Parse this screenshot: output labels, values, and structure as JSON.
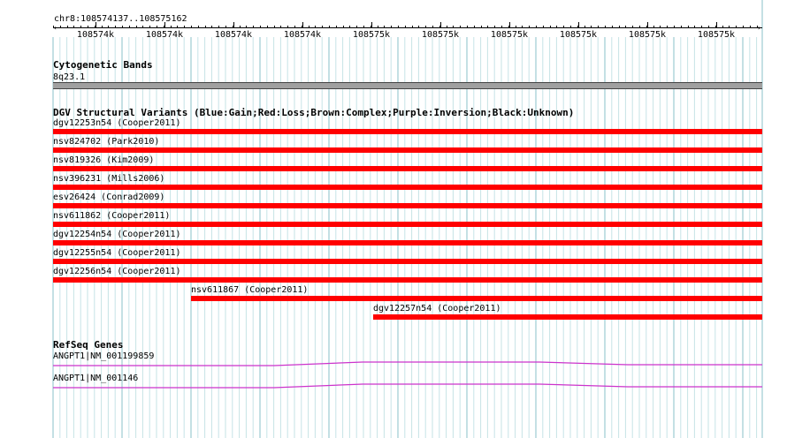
{
  "ruler": {
    "region_label": "chr8:108574137..108575162",
    "ticks": [
      "108574k",
      "108574k",
      "108574k",
      "108574k",
      "108575k",
      "108575k",
      "108575k",
      "108575k",
      "108575k",
      "108575k"
    ]
  },
  "cytoband": {
    "title": "Cytogenetic Bands",
    "band_label": "8q23.1",
    "band_color": "#a0a0a0"
  },
  "dgv": {
    "title": "DGV Structural Variants (Blue:Gain;Red:Loss;Brown:Complex;Purple:Inversion;Black:Unknown)",
    "loss_color": "#ff0000",
    "variants": [
      {
        "label": "dgv12253n54 (Cooper2011)"
      },
      {
        "label": "nsv824702 (Park2010)"
      },
      {
        "label": "nsv819326 (Kim2009)"
      },
      {
        "label": "nsv396231 (Mills2006)"
      },
      {
        "label": "esv26424 (Conrad2009)"
      },
      {
        "label": "nsv611862 (Cooper2011)"
      },
      {
        "label": "dgv12254n54 (Cooper2011)"
      },
      {
        "label": "dgv12255n54 (Cooper2011)"
      },
      {
        "label": "dgv12256n54 (Cooper2011)"
      },
      {
        "label": "nsv611867 (Cooper2011)"
      },
      {
        "label": "dgv12257n54 (Cooper2011)"
      }
    ]
  },
  "refseq": {
    "title": "RefSeq Genes",
    "gene_color": "#cc33cc",
    "genes": [
      {
        "label": "ANGPT1|NM_001199859"
      },
      {
        "label": "ANGPT1|NM_001146"
      }
    ]
  }
}
